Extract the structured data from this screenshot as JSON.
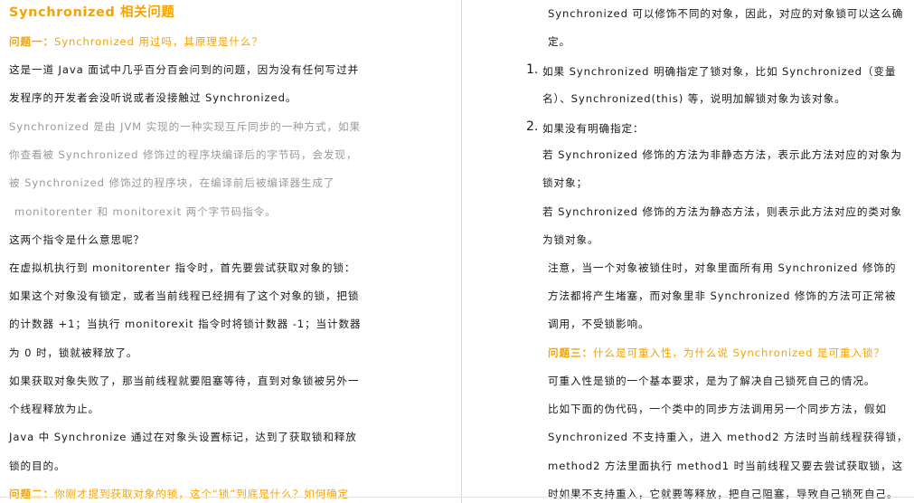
{
  "left": {
    "title": "Synchronized 相关问题",
    "q1_label": "问题一：",
    "q1_text": "Synchronized 用过吗，其原理是什么？",
    "lines": [
      "这是一道 Java 面试中几乎百分百会问到的问题，因为没有任何写过并",
      "发程序的开发者会没听说或者没接触过 Synchronized。",
      "Synchronized 是由 JVM 实现的一种实现互斥同步的一种方式，如果",
      "你查看被 Synchronized 修饰过的程序块编译后的字节码，会发现，",
      "被      Synchronized      修饰过的程序块，在编译前后被编译器生成了",
      "monitorenter 和 monitorexit 两个字节码指令。",
      "这两个指令是什么意思呢？",
      "在虚拟机执行到 monitorenter 指令时，首先要尝试获取对象的锁：",
      "如果这个对象没有锁定，或者当前线程已经拥有了这个对象的锁，把锁",
      "的计数器 +1；当执行 monitorexit 指令时将锁计数器 -1；当计数器",
      "为 0 时，锁就被释放了。",
      "如果获取对象失败了，那当前线程就要阻塞等待，直到对象锁被另外一",
      "个线程释放为止。",
      "Java   中   Synchronize   通过在对象头设置标记，达到了获取锁和释放",
      "锁的目的。"
    ],
    "q2_label": "问题二：",
    "q2_text": "你刚才提到获取对象的锁，这个“锁”到底是什么？如何确定"
  },
  "right": {
    "intro1": "Synchronized 可以修饰不同的对象，因此，对应的对象锁可以这么确",
    "intro2": "定。",
    "item1_num": "1.",
    "item1_l1": "如果 Synchronized 明确指定了锁对象，比如 Synchronized（变量",
    "item1_l2": "名）、Synchronized(this) 等，说明加解锁对象为该对象。",
    "item2_num": "2.",
    "item2_l1": "如果没有明确指定：",
    "sub1_l1": "若  Synchronized  修饰的方法为非静态方法，表示此方法对应的对象为",
    "sub1_l2": "锁对象；",
    "sub2_l1": "若  Synchronized  修饰的方法为静态方法，则表示此方法对应的类对象",
    "sub2_l2": "为锁对象。",
    "note_l1": "注意，当一个对象被锁住时，对象里面所有用 Synchronized 修饰的",
    "note_l2": "方法都将产生堵塞，而对象里非 Synchronized 修饰的方法可正常被",
    "note_l3": "调用，不受锁影响。",
    "q3_label": "问题三：",
    "q3_text": "什么是可重入性，为什么说 Synchronized 是可重入锁？",
    "p1": "可重入性是锁的一个基本要求，是为了解决自己锁死自己的情况。",
    "p2": "比如下面的伪代码，一个类中的同步方法调用另一个同步方法，假如",
    "p3": "Synchronized 不支持重入，进入 method2 方法时当前线程获得锁，",
    "p4": "method2 方法里面执行 method1 时当前线程又要去尝试获取锁，这",
    "p5": "时如果不支持重入，它就要等释放，把自己阻塞，导致自己锁死自己。"
  }
}
